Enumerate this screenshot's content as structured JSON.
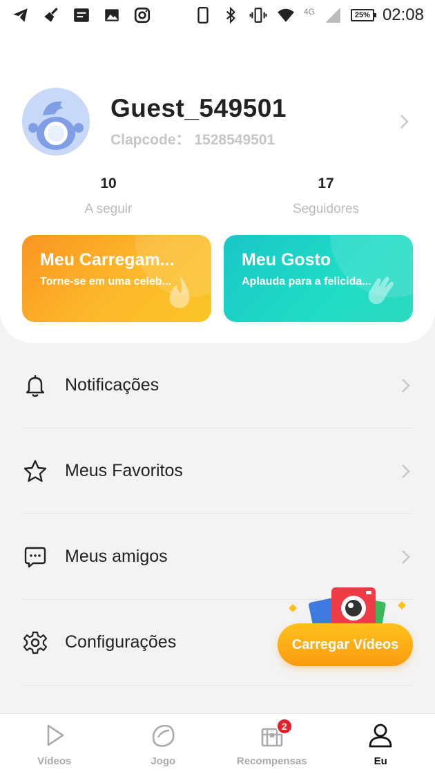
{
  "status_bar": {
    "network": "4G",
    "battery": "25%",
    "time": "02:08"
  },
  "profile": {
    "username": "Guest_549501",
    "clapcode_label": "Clapcode：",
    "clapcode_value": "1528549501"
  },
  "stats": {
    "following_count": "10",
    "following_label": "A seguir",
    "followers_count": "17",
    "followers_label": "Seguidores"
  },
  "promo_cards": [
    {
      "title": "Meu Carregam...",
      "subtitle": "Torne-se em uma celeb...",
      "color": "#fca62a"
    },
    {
      "title": "Meu Gosto",
      "subtitle": "Aplauda para a felicida...",
      "color": "#1fd3c6"
    }
  ],
  "menu": [
    {
      "label": "Notificações",
      "icon": "bell-icon"
    },
    {
      "label": "Meus Favoritos",
      "icon": "star-icon"
    },
    {
      "label": "Meus amigos",
      "icon": "chat-icon"
    },
    {
      "label": "Configurações",
      "icon": "gear-icon"
    }
  ],
  "upload_button": {
    "label": "Carregar Vídeos",
    "color": "#fdb01a"
  },
  "bottom_nav": [
    {
      "label": "Vídeos",
      "icon": "play-icon"
    },
    {
      "label": "Jogo",
      "icon": "game-icon"
    },
    {
      "label": "Recompensas",
      "icon": "treasure-chest-icon",
      "badge": "2"
    },
    {
      "label": "Eu",
      "icon": "person-icon",
      "active": true
    }
  ]
}
